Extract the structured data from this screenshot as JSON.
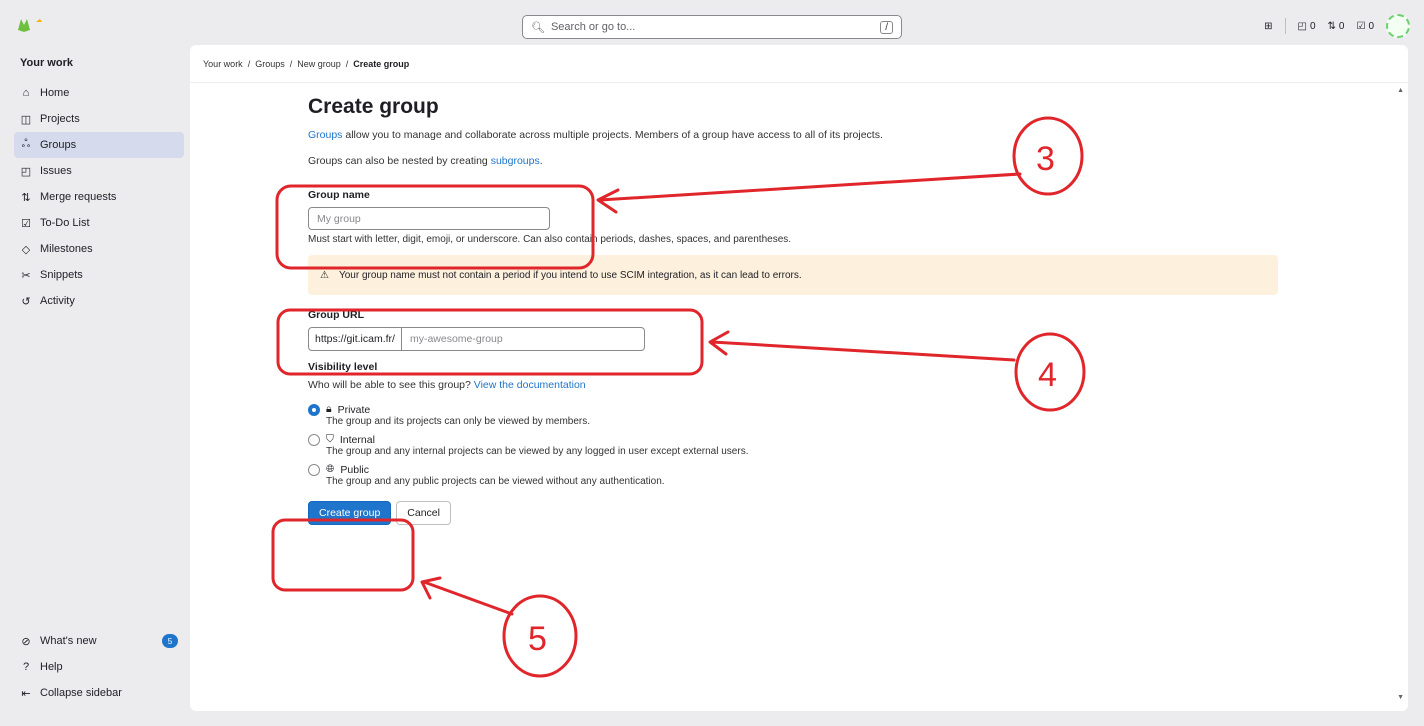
{
  "topbar": {
    "search_placeholder": "Search or go to...",
    "search_shortcut": "/",
    "issues_count": "0",
    "mr_count": "0",
    "todo_count": "0"
  },
  "sidebar": {
    "title": "Your work",
    "items": [
      {
        "label": "Home",
        "icon": "home-icon",
        "glyph": "⌂"
      },
      {
        "label": "Projects",
        "icon": "project-icon",
        "glyph": "◫"
      },
      {
        "label": "Groups",
        "icon": "group-icon",
        "glyph": "ஃ"
      },
      {
        "label": "Issues",
        "icon": "issues-icon",
        "glyph": "◰"
      },
      {
        "label": "Merge requests",
        "icon": "merge-request-icon",
        "glyph": "⇅"
      },
      {
        "label": "To-Do List",
        "icon": "todo-icon",
        "glyph": "☑"
      },
      {
        "label": "Milestones",
        "icon": "milestone-icon",
        "glyph": "◇"
      },
      {
        "label": "Snippets",
        "icon": "snippet-icon",
        "glyph": "✂"
      },
      {
        "label": "Activity",
        "icon": "activity-icon",
        "glyph": "↺"
      }
    ],
    "whats_new": "What's new",
    "whats_new_badge": "5",
    "help": "Help",
    "collapse": "Collapse sidebar"
  },
  "breadcrumb": {
    "items": [
      "Your work",
      "Groups",
      "New group"
    ],
    "current": "Create group",
    "separator": "/"
  },
  "form": {
    "title": "Create group",
    "intro_link": "Groups",
    "intro_text": " allow you to manage and collaborate across multiple projects. Members of a group have access to all of its projects.",
    "nested_text": "Groups can also be nested by creating ",
    "nested_link": "subgroups",
    "nested_end": ".",
    "group_name_label": "Group name",
    "group_name_placeholder": "My group",
    "group_name_hint": "Must start with letter, digit, emoji, or underscore. Can also contain periods, dashes, spaces, and parentheses.",
    "alert_text": "Your group name must not contain a period if you intend to use SCIM integration, as it can lead to errors.",
    "group_url_label": "Group URL",
    "url_prefix": "https://git.icam.fr/",
    "url_placeholder": "my-awesome-group",
    "visibility_label": "Visibility level",
    "visibility_question": "Who will be able to see this group? ",
    "visibility_link": "View the documentation",
    "visibility_options": [
      {
        "label": "Private",
        "desc": "The group and its projects can only be viewed by members.",
        "selected": true
      },
      {
        "label": "Internal",
        "desc": "The group and any internal projects can be viewed by any logged in user except external users.",
        "selected": false
      },
      {
        "label": "Public",
        "desc": "The group and any public projects can be viewed without any authentication.",
        "selected": false
      }
    ],
    "create_button": "Create group",
    "cancel_button": "Cancel"
  },
  "annotations": {
    "labels": [
      "3",
      "4",
      "5"
    ],
    "color": "#e0262b"
  },
  "colors": {
    "accent": "#1f75cb",
    "alert_bg": "#fdf1dd",
    "annotation": "#e0262b"
  }
}
